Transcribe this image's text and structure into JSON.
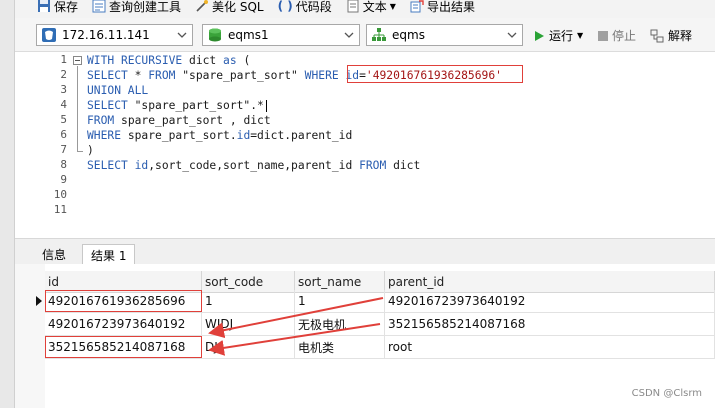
{
  "toolbar": {
    "save_label": "保存",
    "query_builder_label": "查询创建工具",
    "beautify_label": "美化 SQL",
    "snippet_label": "代码段",
    "text_label": "文本",
    "export_label": "导出结果"
  },
  "connection_bar": {
    "host": "172.16.11.141",
    "database": "eqms1",
    "schema": "eqms",
    "run_label": "运行",
    "stop_label": "停止",
    "explain_label": "解释"
  },
  "editor": {
    "line_numbers": [
      "1",
      "2",
      "3",
      "4",
      "5",
      "6",
      "7",
      "8",
      "9",
      "10",
      "11"
    ],
    "lines": [
      [
        {
          "t": "WITH RECURSIVE ",
          "c": "kw"
        },
        {
          "t": "dict ",
          "c": "plain"
        },
        {
          "t": "as",
          "c": "kw"
        },
        {
          "t": " (",
          "c": "plain"
        }
      ],
      [
        {
          "t": "SELECT ",
          "c": "kw"
        },
        {
          "t": "* ",
          "c": "plain"
        },
        {
          "t": "FROM ",
          "c": "kw"
        },
        {
          "t": "\"spare_part_sort\" ",
          "c": "plain"
        },
        {
          "t": "WHERE ",
          "c": "kw"
        },
        {
          "t": "id",
          "c": "kw"
        },
        {
          "t": "=",
          "c": "plain"
        },
        {
          "t": "'492016761936285696'",
          "c": "str"
        }
      ],
      [
        {
          "t": "UNION ALL",
          "c": "kw"
        }
      ],
      [
        {
          "t": "SELECT ",
          "c": "kw"
        },
        {
          "t": "\"spare_part_sort\".*",
          "c": "plain"
        }
      ],
      [
        {
          "t": "FROM ",
          "c": "kw"
        },
        {
          "t": "spare_part_sort , dict",
          "c": "plain"
        }
      ],
      [
        {
          "t": "WHERE ",
          "c": "kw"
        },
        {
          "t": "spare_part_sort.",
          "c": "plain"
        },
        {
          "t": "id",
          "c": "kw"
        },
        {
          "t": "=dict.parent_id",
          "c": "plain"
        }
      ],
      [
        {
          "t": ")",
          "c": "plain"
        }
      ],
      [
        {
          "t": "SELECT ",
          "c": "kw"
        },
        {
          "t": "id",
          "c": "kw"
        },
        {
          "t": ",sort_code,sort_name,parent_id ",
          "c": "plain"
        },
        {
          "t": "FROM ",
          "c": "kw"
        },
        {
          "t": "dict",
          "c": "plain"
        }
      ],
      [],
      [],
      []
    ]
  },
  "tabs": [
    {
      "label": "信息"
    },
    {
      "label": "结果 1"
    }
  ],
  "results": {
    "columns": [
      "id",
      "sort_code",
      "sort_name",
      "parent_id"
    ],
    "rows": [
      [
        "492016761936285696",
        "1",
        "1",
        "492016723973640192"
      ],
      [
        "492016723973640192",
        "WJDJ",
        "无极电机",
        "352156585214087168"
      ],
      [
        "352156585214087168",
        "DJ",
        "电机类",
        "root"
      ]
    ]
  },
  "watermark": "CSDN @Clsrm",
  "colors": {
    "keyword": "#2a5db0",
    "string": "#a31515",
    "annotation": "#e0403a",
    "run_green": "#2aa336"
  }
}
